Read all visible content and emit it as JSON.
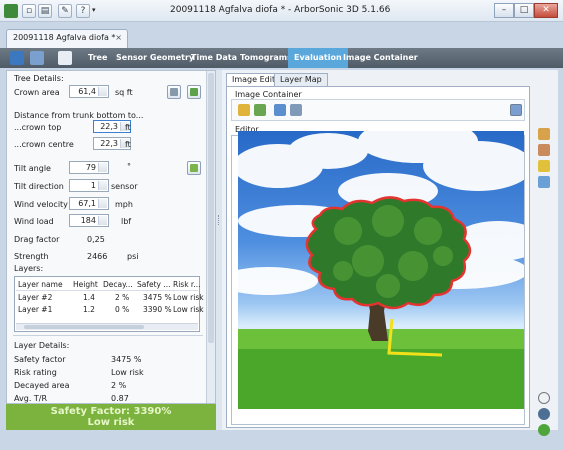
{
  "window": {
    "title": "20091118 Agfalva diofa * - ArborSonic 3D 5.1.66",
    "minimize": "–",
    "maximize": "□",
    "close": "✕"
  },
  "doc_tab": {
    "label": "20091118 Agfalva diofa *",
    "close": "×"
  },
  "nav": {
    "items": [
      "Tree",
      "Sensor Geometry",
      "Time Data",
      "Tomograms",
      "Evaluation",
      "Image Container"
    ],
    "active": "Evaluation"
  },
  "tree_details": {
    "header": "Tree Details:",
    "crown_area": {
      "label": "Crown area",
      "value": "61,4",
      "unit": "sq ft"
    },
    "distance_header": "Distance from trunk bottom to...",
    "crown_top": {
      "label": "...crown top",
      "value": "22,3",
      "unit": "ft"
    },
    "crown_centre": {
      "label": "...crown centre",
      "value": "22,3",
      "unit": "ft"
    },
    "tilt_angle": {
      "label": "Tilt angle",
      "value": "79",
      "unit": "°"
    },
    "tilt_direction": {
      "label": "Tilt direction",
      "value": "1",
      "unit": "sensor"
    },
    "wind_velocity": {
      "label": "Wind velocity",
      "value": "67,1",
      "unit": "mph"
    },
    "wind_load": {
      "label": "Wind load",
      "value": "184",
      "unit": "lbf"
    },
    "drag_factor": {
      "label": "Drag factor",
      "value": "0,25"
    },
    "strength": {
      "label": "Strength",
      "value": "2466",
      "unit": "psi"
    }
  },
  "layers": {
    "header": "Layers:",
    "columns": [
      "Layer name",
      "Height",
      "Decay...",
      "Safety ...",
      "Risk r..."
    ],
    "rows": [
      [
        "Layer #2",
        "1.4",
        "2 %",
        "3475 %",
        "Low risk"
      ],
      [
        "Layer #1",
        "1.2",
        "0 %",
        "3390 %",
        "Low risk"
      ]
    ]
  },
  "layer_details": {
    "header": "Layer Details:",
    "safety_factor": {
      "label": "Safety factor",
      "value": "3475 %"
    },
    "risk_rating": {
      "label": "Risk rating",
      "value": "Low risk"
    },
    "decayed_area": {
      "label": "Decayed area",
      "value": "2 %"
    },
    "avg_tr": {
      "label": "Avg. T/R",
      "value": "0.87"
    }
  },
  "safety_bar": {
    "line1": "Safety Factor: 3390%",
    "line2": "Low risk"
  },
  "right_tabs": [
    "Image Editor",
    "Layer Map"
  ],
  "image_container": {
    "label": "Image Container"
  },
  "editor": {
    "label": "Editor"
  },
  "colors": {
    "nav_active": "#5aa7dc",
    "safety_green": "#7cb23e",
    "outline_red": "#e3342f",
    "trunk_line": "#f2e11a"
  }
}
